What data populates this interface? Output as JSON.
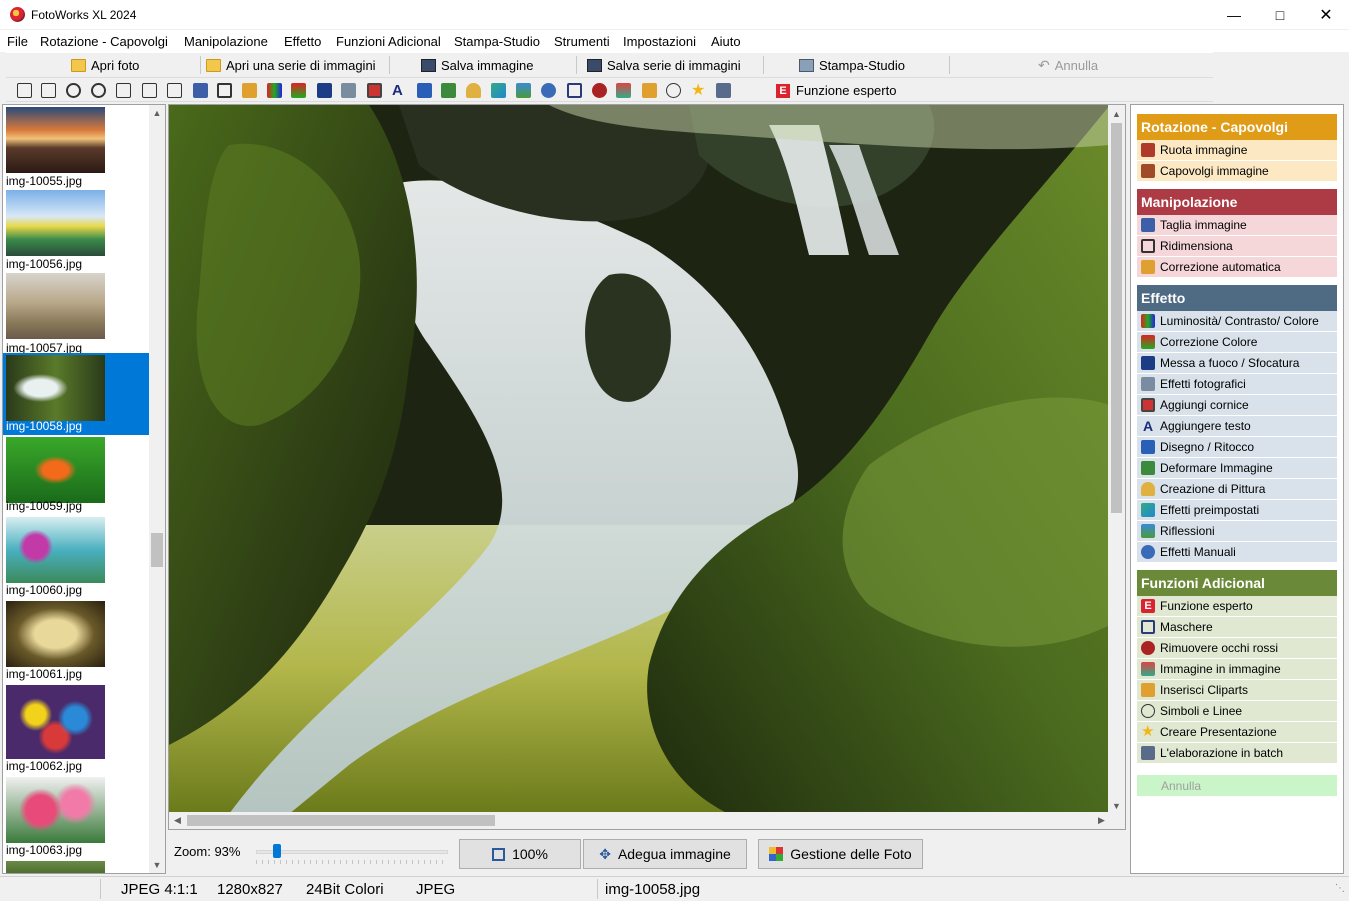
{
  "window": {
    "title": "FotoWorks XL 2024"
  },
  "menu": [
    "File",
    "Rotazione - Capovolgi",
    "Manipolazione",
    "Effetto",
    "Funzioni Adicional",
    "Stampa-Studio",
    "Strumenti",
    "Impostazioni",
    "Aiuto"
  ],
  "toolbar": {
    "open_photo": "Apri foto",
    "open_series": "Apri una serie di immagini",
    "save_image": "Salva immagine",
    "save_series": "Salva serie di immagini",
    "print_studio": "Stampa-Studio",
    "undo": "Annulla",
    "expert": "Funzione esperto"
  },
  "thumbnails": [
    {
      "name": "img-10055.jpg"
    },
    {
      "name": "img-10056.jpg"
    },
    {
      "name": "img-10057.jpg"
    },
    {
      "name": "img-10058.jpg",
      "selected": true
    },
    {
      "name": "img-10059.jpg"
    },
    {
      "name": "img-10060.jpg"
    },
    {
      "name": "img-10061.jpg"
    },
    {
      "name": "img-10062.jpg"
    },
    {
      "name": "img-10063.jpg"
    }
  ],
  "zoom": {
    "label": "Zoom: 93%",
    "value": 0.09,
    "btn_100": "100%",
    "btn_fit": "Adegua immagine",
    "btn_manage": "Gestione delle Foto"
  },
  "side": {
    "groups": [
      {
        "title": "Rotazione - Capovolgi",
        "color": "#e09b17",
        "bg": "#fce9c4",
        "items": [
          "Ruota immagine",
          "Capovolgi immagine"
        ]
      },
      {
        "title": "Manipolazione",
        "color": "#ad3b45",
        "bg": "#f5d7da",
        "items": [
          "Taglia immagine",
          "Ridimensiona",
          "Correzione automatica"
        ]
      },
      {
        "title": "Effetto",
        "color": "#4f6a83",
        "bg": "#d9e2ea",
        "items": [
          "Luminosità/ Contrasto/ Colore",
          "Correzione Colore",
          "Messa a fuoco / Sfocatura",
          "Effetti fotografici",
          "Aggiungi cornice",
          "Aggiungere testo",
          "Disegno / Ritocco",
          "Deformare Immagine",
          "Creazione di Pittura",
          "Effetti preimpostati",
          "Riflessioni",
          "Effetti Manuali"
        ]
      },
      {
        "title": "Funzioni Adicional",
        "color": "#6a8a3a",
        "bg": "#e0e8d2",
        "items": [
          "Funzione esperto",
          "Maschere",
          "Rimuovere occhi rossi",
          "Immagine in immagine",
          "Inserisci Cliparts",
          "Simboli e Linee",
          "Creare Presentazione",
          "L'elaborazione in batch"
        ]
      }
    ],
    "undo": "Annulla"
  },
  "status": {
    "format": "JPEG  4:1:1",
    "size": "1280x827",
    "colors": "24Bit Colori",
    "type": "JPEG",
    "file": "img-10058.jpg"
  }
}
